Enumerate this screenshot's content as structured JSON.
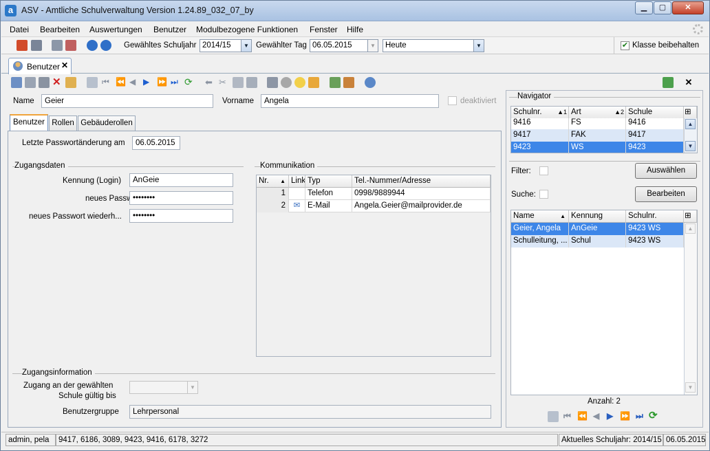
{
  "window": {
    "title": "ASV - Amtliche Schulverwaltung Version 1.24.89_032_07_by",
    "app_icon": "a"
  },
  "menu": [
    "Datei",
    "Bearbeiten",
    "Auswertungen",
    "Benutzer",
    "Modulbezogene Funktionen",
    "Fenster",
    "Hilfe"
  ],
  "toolbar": {
    "schuljahr_label": "Gewähltes Schuljahr",
    "schuljahr_value": "2014/15",
    "tag_label": "Gewählter Tag",
    "tag_value": "06.05.2015",
    "heute_value": "Heute",
    "klasse_label": "Klasse beibehalten",
    "klasse_checked": true
  },
  "doc_tab": {
    "label": "Benutzer",
    "close": "✕"
  },
  "form": {
    "name_label": "Name",
    "name_value": "Geier",
    "vorname_label": "Vorname",
    "vorname_value": "Angela",
    "deaktiviert_label": "deaktiviert"
  },
  "subtabs": [
    "Benutzer",
    "Rollen",
    "Gebäuderollen"
  ],
  "benutzer": {
    "pw_change_label": "Letzte Passwortänderung am",
    "pw_change_value": "06.05.2015",
    "zugangsdaten_title": "Zugangsdaten",
    "kennung_label": "Kennung (Login)",
    "kennung_value": "AnGeie",
    "pw_label": "neues Passwort",
    "pw_value": "••••••••",
    "pw2_label": "neues Passwort wiederh...",
    "pw2_value": "••••••••",
    "komm_title": "Kommunikation",
    "komm_headers": [
      "Nr.",
      "Link",
      "Typ",
      "Tel.-Nummer/Adresse"
    ],
    "komm_rows": [
      {
        "nr": "1",
        "typ": "Telefon",
        "adresse": "0998/9889944"
      },
      {
        "nr": "2",
        "typ": "E-Mail",
        "adresse": "Angela.Geier@mailprovider.de"
      }
    ],
    "zugangsinfo_title": "Zugangsinformation",
    "zugang_label_1": "Zugang an der gewählten",
    "zugang_label_2": "Schule gültig bis",
    "gruppe_label": "Benutzergruppe",
    "gruppe_value": "Lehrpersonal"
  },
  "navigator": {
    "title": "Navigator",
    "schulen_headers": [
      "Schulnr.",
      "Art",
      "Schule"
    ],
    "schulen_sort": [
      "1",
      "2"
    ],
    "schulen_rows": [
      {
        "nr": "9416",
        "art": "FS",
        "schule": "9416"
      },
      {
        "nr": "9417",
        "art": "FAK",
        "schule": "9417"
      },
      {
        "nr": "9423",
        "art": "WS",
        "schule": "9423"
      }
    ],
    "filter_label": "Filter:",
    "suche_label": "Suche:",
    "auswaehlen": "Auswählen",
    "bearbeiten": "Bearbeiten",
    "result_headers": [
      "Name",
      "Kennung",
      "Schulnr."
    ],
    "result_rows": [
      {
        "name": "Geier, Angela",
        "kennung": "AnGeie",
        "schulnr": "9423 WS"
      },
      {
        "name": "Schulleitung, ...",
        "kennung": "Schul",
        "schulnr": "9423 WS"
      }
    ],
    "anzahl": "Anzahl: 2"
  },
  "status": {
    "user": "admin, pela",
    "schools": "9417, 6186, 3089, 9423, 9416, 6178, 3272",
    "schuljahr": "Aktuelles Schuljahr: 2014/15",
    "date": "06.05.2015"
  }
}
